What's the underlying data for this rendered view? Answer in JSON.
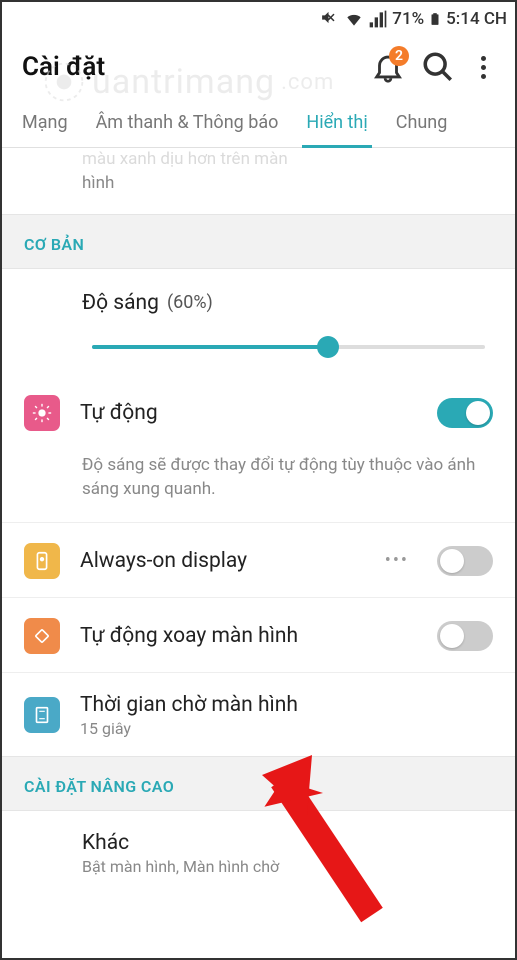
{
  "status": {
    "battery_pct": "71%",
    "time": "5:14 CH"
  },
  "header": {
    "title": "Cài đặt",
    "notification_badge": "2"
  },
  "tabs": {
    "items": [
      "Mạng",
      "Âm thanh & Thông báo",
      "Hiển thị",
      "Chung"
    ],
    "active_index": 2
  },
  "clipped_top": {
    "line1": "màu xanh dịu hơn trên màn",
    "line2": "hình"
  },
  "section_basic": "CƠ BẢN",
  "brightness": {
    "label": "Độ sáng",
    "pct_text": "(60%)",
    "value": 60
  },
  "auto_brightness": {
    "label": "Tự động",
    "on": true,
    "desc": "Độ sáng sẽ được thay đổi tự động tùy thuộc vào ánh sáng xung quanh."
  },
  "aod": {
    "label": "Always-on display",
    "on": false
  },
  "auto_rotate": {
    "label": "Tự động xoay màn hình",
    "on": false
  },
  "screen_timeout": {
    "label": "Thời gian chờ màn hình",
    "value": "15 giây"
  },
  "section_advanced": "CÀI ĐẶT NÂNG CAO",
  "other": {
    "label": "Khác",
    "sub": "Bật màn hình, Màn hình chờ"
  },
  "watermark_text": "uantrimang"
}
